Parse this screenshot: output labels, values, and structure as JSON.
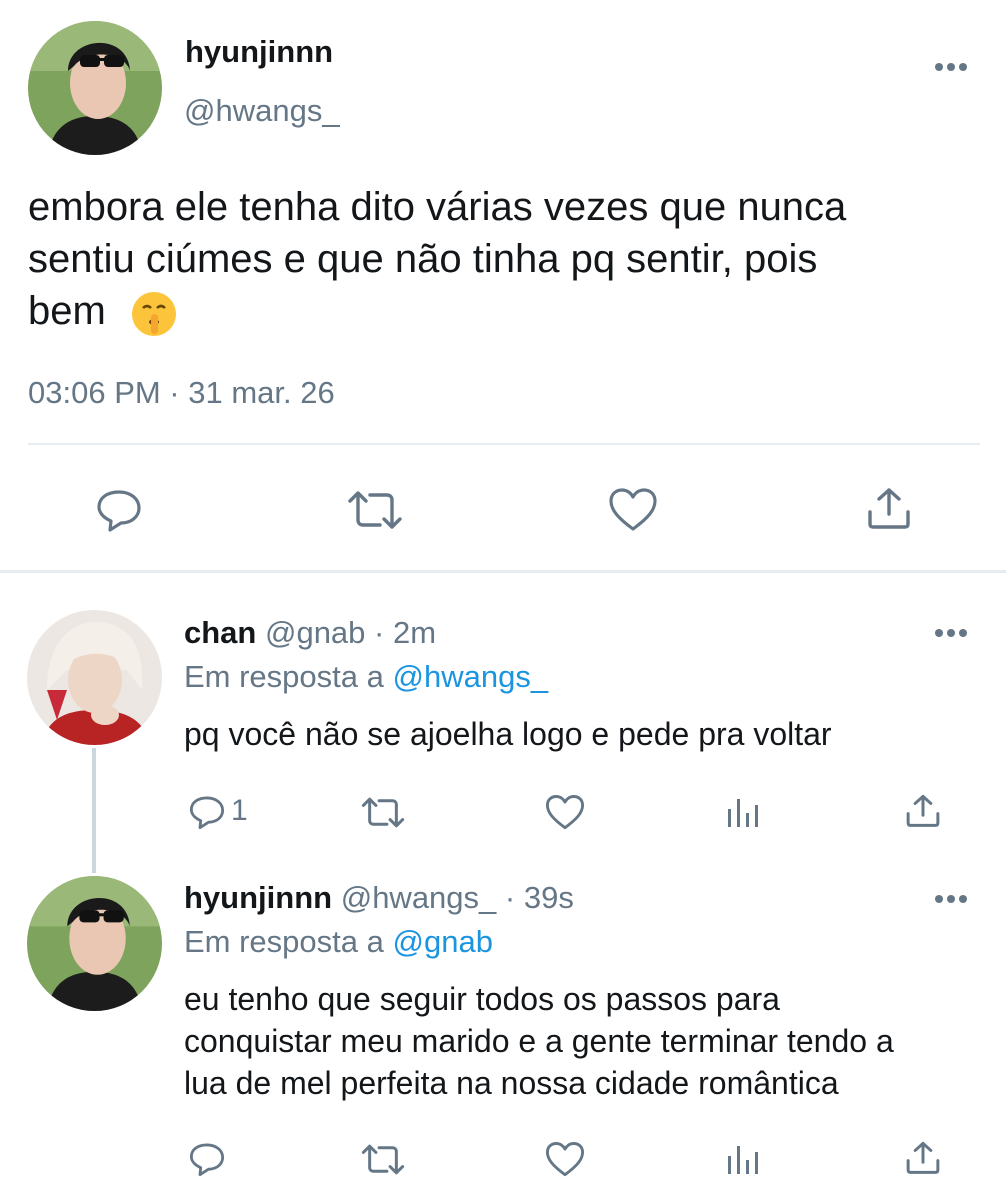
{
  "main_tweet": {
    "display_name": "hyunjinnn",
    "handle": "@hwangs_",
    "text_line1": "embora ele tenha dito várias vezes que nunca",
    "text_line2": "sentiu ciúmes e que não tinha pq sentir, pois",
    "text_line3": "bem",
    "emoji": "shushing-face",
    "timestamp": "03:06 PM · 31 mar. 26",
    "actions": [
      "reply-icon",
      "retweet-icon",
      "like-icon",
      "share-icon"
    ]
  },
  "replies": [
    {
      "display_name": "chan",
      "handle": "@gnab",
      "time": "· 2m",
      "reply_prefix": "Em resposta a",
      "reply_to": "@hwangs_",
      "text_lines": [
        "pq você não se ajoelha logo e pede pra voltar"
      ],
      "reply_count": "1",
      "actions": [
        "reply-icon",
        "retweet-icon",
        "like-icon",
        "analytics-icon",
        "share-icon"
      ]
    },
    {
      "display_name": "hyunjinnn",
      "handle": "@hwangs_",
      "time": "· 39s",
      "reply_prefix": "Em resposta a",
      "reply_to": "@gnab",
      "text_lines": [
        "eu tenho que seguir todos os passos para",
        "conquistar meu marido e a gente terminar tendo a",
        "lua de mel perfeita na nossa cidade romântica"
      ],
      "actions": [
        "reply-icon",
        "retweet-icon",
        "like-icon",
        "analytics-icon",
        "share-icon"
      ]
    }
  ],
  "colors": {
    "text": "#14171a",
    "secondary": "#657786",
    "link": "#1b95e0",
    "divider": "#e6ecf0"
  }
}
